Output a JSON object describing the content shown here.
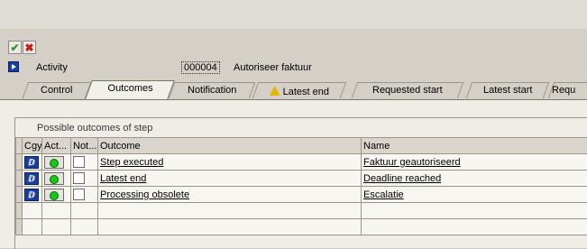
{
  "toolbar": {
    "confirm_icon": "check-icon",
    "cancel_icon": "cross-icon"
  },
  "activity": {
    "label": "Activity",
    "number": "000004",
    "name": "Autoriseer faktuur"
  },
  "tabs": [
    {
      "label": "Control"
    },
    {
      "label": "Outcomes"
    },
    {
      "label": "Notification"
    },
    {
      "label": "Latest end"
    },
    {
      "label": "Requested start"
    },
    {
      "label": "Latest start"
    },
    {
      "label": "Requ"
    }
  ],
  "group": {
    "title": "Possible outcomes of step"
  },
  "table": {
    "headers": {
      "cgy": "Cgy",
      "act": "Act...",
      "not": "Not...",
      "outcome": "Outcome",
      "name": "Name"
    },
    "rows": [
      {
        "cgy": "ⅅ",
        "outcome": "Step executed",
        "name": "Faktuur geautoriseerd"
      },
      {
        "cgy": "ⅅ",
        "outcome": "Latest end",
        "name": "Deadline reached"
      },
      {
        "cgy": "ⅅ",
        "outcome": "Processing obsolete",
        "name": "Escalatie"
      }
    ]
  }
}
